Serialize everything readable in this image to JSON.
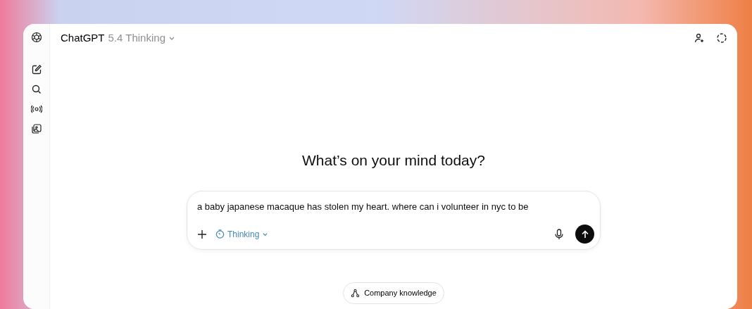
{
  "header": {
    "title": "ChatGPT",
    "model": "5.4 Thinking"
  },
  "heading": "What’s on your mind today?",
  "composer": {
    "value": "a baby japanese macaque has stolen my heart. where can i volunteer in nyc to be",
    "mode": "Thinking"
  },
  "chips": [
    "Company knowledge"
  ]
}
